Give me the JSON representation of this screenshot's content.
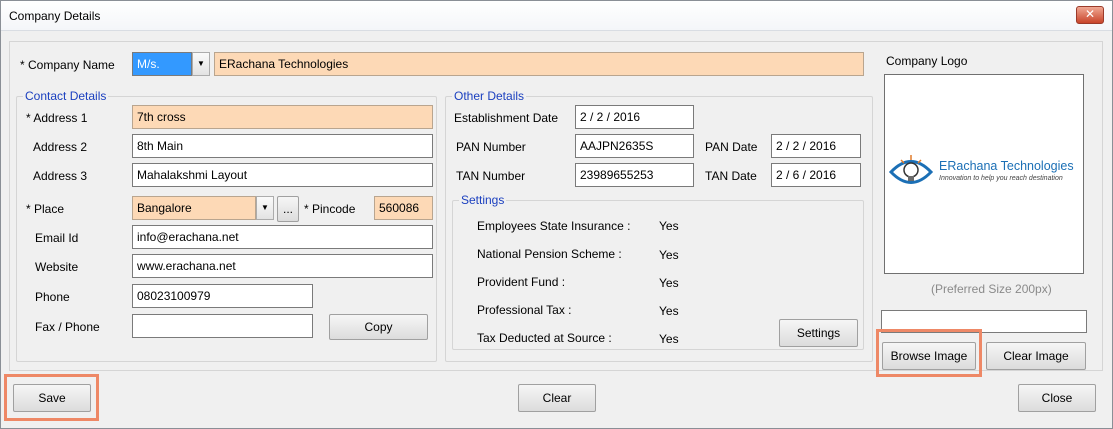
{
  "window": {
    "title": "Company Details",
    "close_glyph": "✕"
  },
  "company": {
    "label": "* Company Name",
    "prefix": "M/s.",
    "name": "ERachana Technologies"
  },
  "contact": {
    "group_title": "Contact Details",
    "address1_label": "* Address 1",
    "address1": "7th cross",
    "address2_label": "Address 2",
    "address2": "8th Main",
    "address3_label": "Address 3",
    "address3": "Mahalakshmi Layout",
    "place_label": "* Place",
    "place": "Bangalore",
    "place_browse": "...",
    "pincode_label": "* Pincode",
    "pincode": "560086",
    "email_label": "Email Id",
    "email": "info@erachana.net",
    "website_label": "Website",
    "website": "www.erachana.net",
    "phone_label": "Phone",
    "phone": "08023100979",
    "fax_label": "Fax / Phone",
    "fax": "",
    "copy_button": "Copy"
  },
  "other": {
    "group_title": "Other Details",
    "establishment_label": "Establishment Date",
    "establishment_date": "2 / 2 / 2016",
    "pan_label": "PAN Number",
    "pan": "AAJPN2635S",
    "pan_date_label": "PAN Date",
    "pan_date": "2 / 2 / 2016",
    "tan_label": "TAN Number",
    "tan": "23989655253",
    "tan_date_label": "TAN Date",
    "tan_date": "2 / 6 / 2016"
  },
  "settings": {
    "group_title": "Settings",
    "items": [
      {
        "label": "Employees State Insurance :",
        "value": "Yes"
      },
      {
        "label": "National Pension Scheme :",
        "value": "Yes"
      },
      {
        "label": "Provident Fund :",
        "value": "Yes"
      },
      {
        "label": "Professional Tax :",
        "value": "Yes"
      },
      {
        "label": "Tax Deducted at Source :",
        "value": "Yes"
      }
    ],
    "settings_button": "Settings"
  },
  "logo": {
    "label": "Company Logo",
    "brand_name": "ERachana Technologies",
    "tagline": "Innovation to help you reach destination",
    "preferred_size": "(Preferred Size 200px)",
    "path_value": "",
    "browse_button": "Browse Image",
    "clear_button": "Clear Image"
  },
  "footer": {
    "save_button": "Save",
    "clear_button": "Clear",
    "close_button": "Close"
  },
  "colors": {
    "required_field": "#fdd9b6",
    "group_title": "#1a3fbf",
    "highlight": "#ee8866",
    "selection": "#3399ff"
  }
}
